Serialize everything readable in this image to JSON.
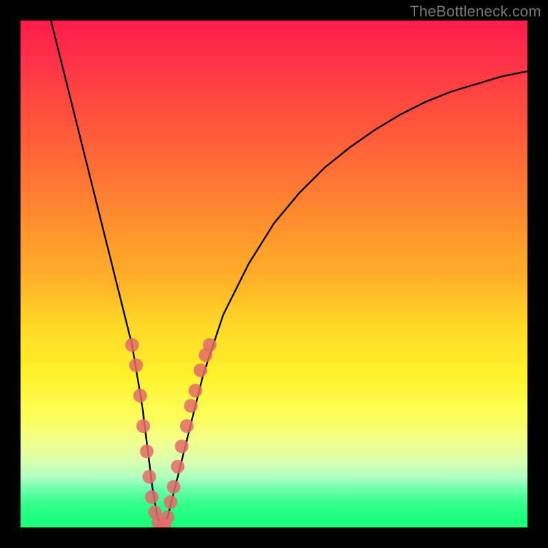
{
  "watermark": "TheBottleneck.com",
  "chart_data": {
    "type": "line",
    "title": "",
    "xlabel": "",
    "ylabel": "",
    "xlim": [
      0,
      100
    ],
    "ylim": [
      0,
      100
    ],
    "series": [
      {
        "name": "bottleneck-curve",
        "x": [
          6,
          8,
          10,
          12,
          14,
          16,
          18,
          20,
          22,
          24,
          25,
          26,
          27,
          28,
          29,
          30,
          32,
          34,
          36,
          40,
          45,
          50,
          55,
          60,
          65,
          70,
          75,
          80,
          85,
          90,
          95,
          100
        ],
        "y": [
          100,
          92,
          84,
          76,
          68,
          60,
          52,
          44,
          36,
          24,
          16,
          8,
          2,
          0,
          2,
          6,
          14,
          22,
          30,
          42,
          52,
          60,
          66,
          71,
          75,
          78.5,
          81.5,
          84,
          86,
          87.5,
          89,
          90
        ]
      }
    ],
    "markers": {
      "name": "highlighted-points",
      "color": "#e46a6a",
      "points": [
        {
          "x": 22.0,
          "y": 36
        },
        {
          "x": 22.8,
          "y": 32
        },
        {
          "x": 23.6,
          "y": 26
        },
        {
          "x": 24.2,
          "y": 20
        },
        {
          "x": 24.9,
          "y": 15
        },
        {
          "x": 25.4,
          "y": 10
        },
        {
          "x": 25.9,
          "y": 6
        },
        {
          "x": 26.5,
          "y": 3
        },
        {
          "x": 27.2,
          "y": 1
        },
        {
          "x": 27.8,
          "y": 0
        },
        {
          "x": 28.4,
          "y": 0.5
        },
        {
          "x": 29.0,
          "y": 2
        },
        {
          "x": 29.6,
          "y": 5
        },
        {
          "x": 30.2,
          "y": 8
        },
        {
          "x": 31.0,
          "y": 12
        },
        {
          "x": 31.8,
          "y": 16
        },
        {
          "x": 32.8,
          "y": 20
        },
        {
          "x": 33.6,
          "y": 24
        },
        {
          "x": 34.5,
          "y": 27
        },
        {
          "x": 35.5,
          "y": 31
        },
        {
          "x": 36.5,
          "y": 34
        },
        {
          "x": 37.3,
          "y": 36
        }
      ]
    }
  }
}
